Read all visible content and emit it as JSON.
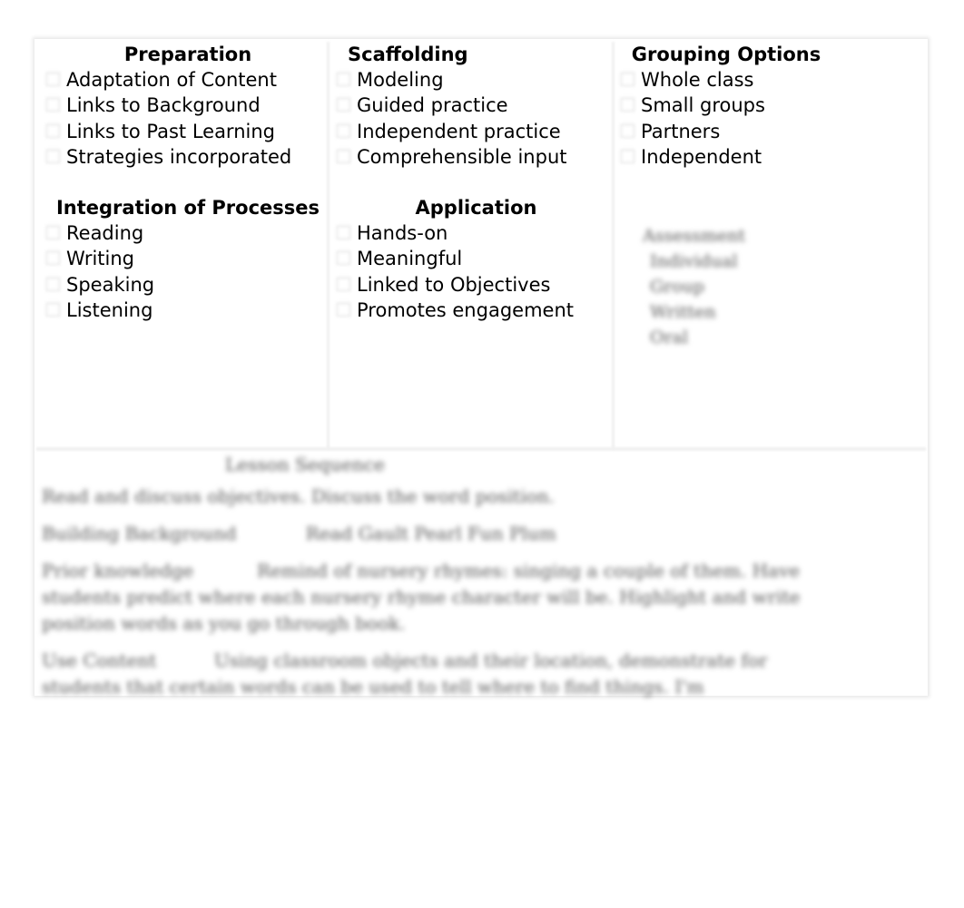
{
  "preparation": {
    "title": "Preparation",
    "items": [
      "Adaptation of Content",
      "Links to Background",
      "Links to Past Learning",
      "Strategies incorporated"
    ]
  },
  "integration": {
    "title": "Integration of Processes",
    "items": [
      "Reading",
      "Writing",
      "Speaking",
      "Listening"
    ]
  },
  "scaffolding": {
    "title": "Scaffolding",
    "items": [
      "Modeling",
      "Guided practice",
      "Independent practice",
      "Comprehensible input"
    ]
  },
  "application": {
    "title": "Application",
    "items": [
      "Hands-on",
      "Meaningful",
      "Linked to Objectives",
      "Promotes engagement"
    ]
  },
  "grouping": {
    "title": "Grouping Options",
    "items": [
      "Whole class",
      "Small groups",
      "Partners",
      "Independent"
    ]
  },
  "assessment": {
    "title": "Assessment",
    "items": [
      "Individual",
      "Group",
      "Written",
      "Oral"
    ]
  },
  "sequence": {
    "title": "Lesson Sequence",
    "lines": [
      "Read and discuss objectives. Discuss the word position.",
      "Building Background            Read Gault Pearl Fun Plum",
      "Prior knowledge           Remind of nursery rhymes: singing a couple of them. Have students predict where each nursery rhyme character will be. Highlight and write position words as you go through book.",
      "Use Content          Using classroom objects and their location, demonstrate for students that certain words can be used to tell where to find things. I'm"
    ]
  }
}
